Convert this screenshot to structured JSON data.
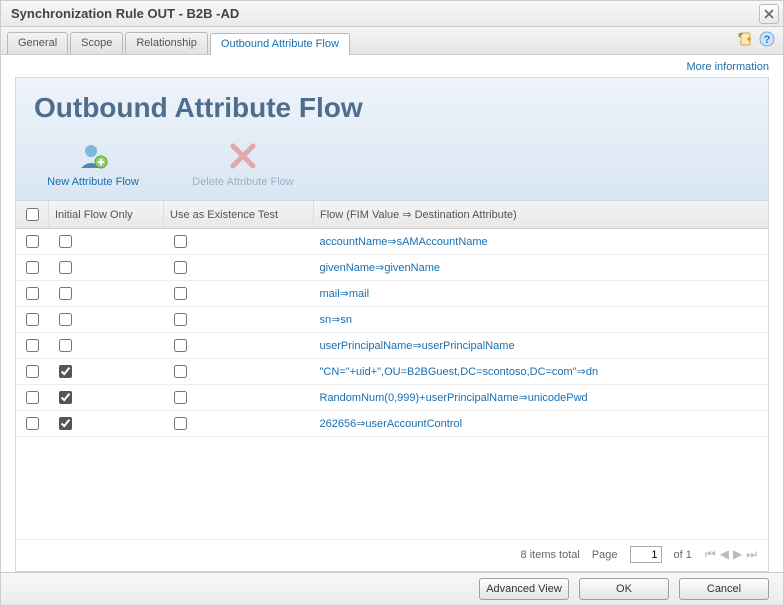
{
  "window": {
    "title": "Synchronization Rule OUT - B2B -AD"
  },
  "tabs": [
    {
      "label": "General",
      "active": false
    },
    {
      "label": "Scope",
      "active": false
    },
    {
      "label": "Relationship",
      "active": false
    },
    {
      "label": "Outbound Attribute Flow",
      "active": true
    }
  ],
  "topright": {
    "moreinfo": "More information"
  },
  "hero": {
    "title": "Outbound Attribute Flow",
    "newflow": "New Attribute Flow",
    "deleteflow": "Delete Attribute Flow"
  },
  "table": {
    "headers": {
      "ifo": "Initial Flow Only",
      "ex": "Use as Existence Test",
      "flow": "Flow (FIM Value ⇒ Destination Attribute)"
    },
    "rows": [
      {
        "ifo": false,
        "ex": false,
        "flow": "accountName⇒sAMAccountName"
      },
      {
        "ifo": false,
        "ex": false,
        "flow": "givenName⇒givenName"
      },
      {
        "ifo": false,
        "ex": false,
        "flow": "mail⇒mail"
      },
      {
        "ifo": false,
        "ex": false,
        "flow": "sn⇒sn"
      },
      {
        "ifo": false,
        "ex": false,
        "flow": "userPrincipalName⇒userPrincipalName"
      },
      {
        "ifo": true,
        "ex": false,
        "flow": "\"CN=\"+uid+\",OU=B2BGuest,DC=scontoso,DC=com\"⇒dn"
      },
      {
        "ifo": true,
        "ex": false,
        "flow": "RandomNum(0,999)+userPrincipalName⇒unicodePwd"
      },
      {
        "ifo": true,
        "ex": false,
        "flow": "262656⇒userAccountControl"
      }
    ]
  },
  "footer": {
    "items_total": "8 items total",
    "page_label_before": "Page",
    "page_value": "1",
    "page_label_after": "of 1"
  },
  "buttons": {
    "advanced": "Advanced View",
    "ok": "OK",
    "cancel": "Cancel"
  }
}
